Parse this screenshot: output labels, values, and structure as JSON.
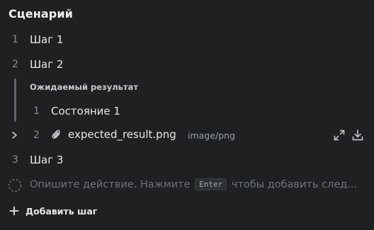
{
  "section": {
    "title": "Сценарий"
  },
  "steps": [
    {
      "number": "1",
      "text": "Шаг 1"
    },
    {
      "number": "2",
      "text": "Шаг 2"
    },
    {
      "number": "3",
      "text": "Шаг 3"
    }
  ],
  "expected": {
    "label": "Ожидаемый результат",
    "items": [
      {
        "number": "1",
        "text": "Состояние 1"
      },
      {
        "number": "2",
        "file_name": "expected_result.png",
        "file_type": "image/png"
      }
    ]
  },
  "new_step": {
    "placeholder_before": "Опишите действие. Нажмите",
    "key": "Enter",
    "placeholder_after": "чтобы добавить след..."
  },
  "add_step": {
    "label": "Добавить шаг"
  },
  "icons": {
    "expand": "expand-arrows-icon",
    "download": "download-icon",
    "attachment": "paperclip-icon",
    "chevron": "chevron-right-icon",
    "new_step": "dashed-circle-icon",
    "add": "plus-icon"
  }
}
